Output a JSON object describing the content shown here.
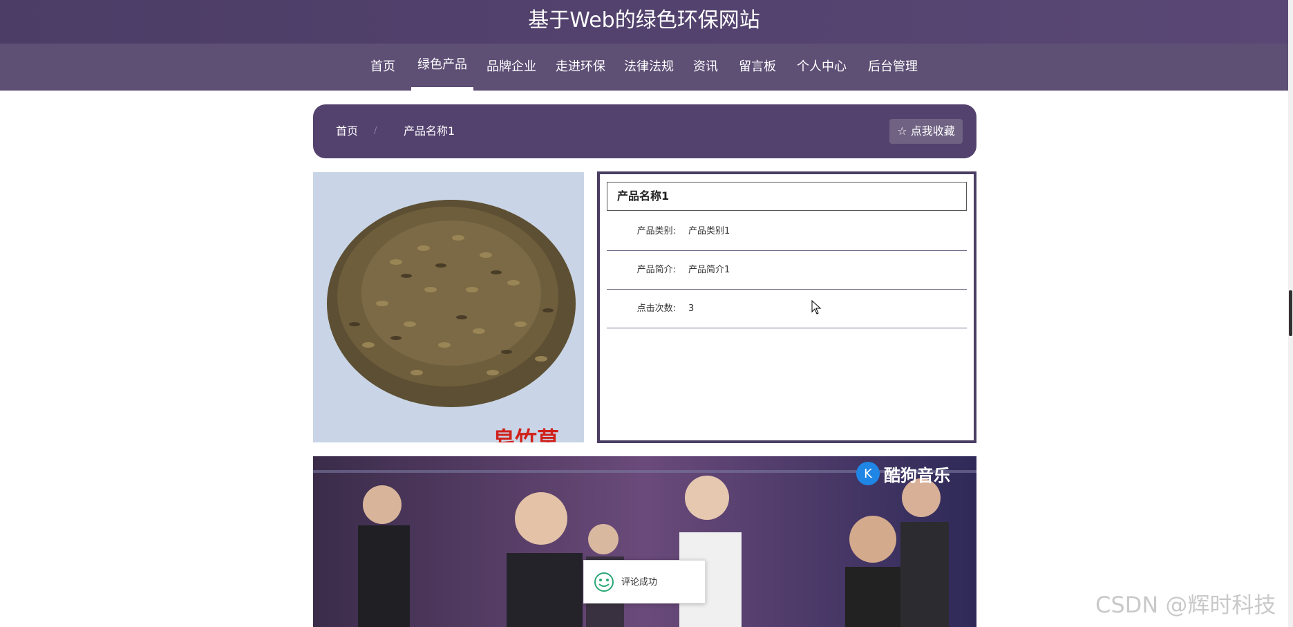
{
  "site": {
    "title": "基于Web的绿色环保网站"
  },
  "nav": {
    "items": [
      {
        "label": "首页",
        "active": false
      },
      {
        "label": "绿色产品",
        "active": true
      },
      {
        "label": "品牌企业",
        "active": false
      },
      {
        "label": "走进环保",
        "active": false
      },
      {
        "label": "法律法规",
        "active": false
      },
      {
        "label": "资讯",
        "active": false
      },
      {
        "label": "留言板",
        "active": false
      },
      {
        "label": "个人中心",
        "active": false
      },
      {
        "label": "后台管理",
        "active": false
      }
    ]
  },
  "breadcrumb": {
    "home": "首页",
    "separator": "/",
    "current": "产品名称1",
    "favorite_button": "☆ 点我收藏"
  },
  "product": {
    "image": {
      "icon": "seeds-photo",
      "overlay_text": "皂竹草"
    },
    "name": "产品名称1",
    "fields": [
      {
        "label": "产品类别:",
        "value": "产品类别1"
      },
      {
        "label": "产品简介:",
        "value": "产品简介1"
      },
      {
        "label": "点击次数:",
        "value": "3"
      }
    ]
  },
  "video": {
    "logo_text": "酷狗音乐",
    "logo_icon": "kugou-icon"
  },
  "toast": {
    "text": "评论成功",
    "icon": "smile-icon"
  },
  "watermark": "CSDN @辉时科技",
  "colors": {
    "header": "#4b3d66",
    "nav": "#5e4f75",
    "breadcrumb": "#53416e",
    "panel_border": "#4a3e63"
  }
}
